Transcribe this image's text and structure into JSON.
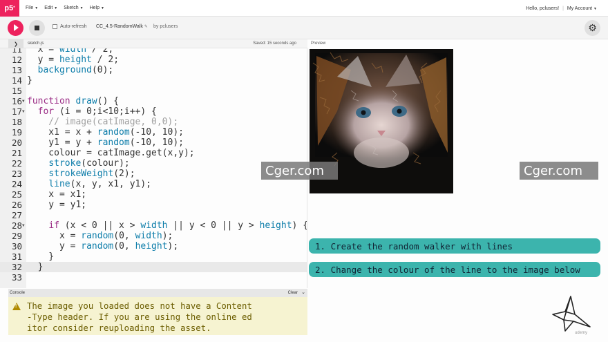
{
  "menubar": {
    "logo": "p5",
    "logo_sup": "*",
    "menus": [
      "File",
      "Edit",
      "Sketch",
      "Help"
    ],
    "greeting": "Hello, pclusers!",
    "account": "My Account"
  },
  "toolbar": {
    "auto_refresh_label": "Auto-refresh",
    "auto_refresh_checked": false,
    "sketch_name": "CC_4.5-RandomWalk",
    "by_user": "by pclusers"
  },
  "editor": {
    "filename": "sketch.js",
    "saved_status": "Saved: 15 seconds ago",
    "lines": [
      {
        "n": "11",
        "code": "  x = width / 2;",
        "fold": false
      },
      {
        "n": "12",
        "code": "  y = height / 2;",
        "fold": false
      },
      {
        "n": "13",
        "code": "  background(0);",
        "fold": false
      },
      {
        "n": "14",
        "code": "}",
        "fold": false
      },
      {
        "n": "15",
        "code": "",
        "fold": false
      },
      {
        "n": "16",
        "code": "function draw() {",
        "fold": true
      },
      {
        "n": "17",
        "code": "  for (i = 0;i<10;i++) {",
        "fold": true
      },
      {
        "n": "18",
        "code": "    // image(catImage, 0,0);",
        "fold": false
      },
      {
        "n": "19",
        "code": "    x1 = x + random(-10, 10);",
        "fold": false
      },
      {
        "n": "20",
        "code": "    y1 = y + random(-10, 10);",
        "fold": false
      },
      {
        "n": "21",
        "code": "    colour = catImage.get(x,y);",
        "fold": false
      },
      {
        "n": "22",
        "code": "    stroke(colour);",
        "fold": false
      },
      {
        "n": "23",
        "code": "    strokeWeight(2);",
        "fold": false
      },
      {
        "n": "24",
        "code": "    line(x, y, x1, y1);",
        "fold": false
      },
      {
        "n": "25",
        "code": "    x = x1;",
        "fold": false
      },
      {
        "n": "26",
        "code": "    y = y1;",
        "fold": false
      },
      {
        "n": "27",
        "code": "",
        "fold": false
      },
      {
        "n": "28",
        "code": "    if (x < 0 || x > width || y < 0 || y > height) {",
        "fold": true
      },
      {
        "n": "29",
        "code": "      x = random(0, width);",
        "fold": false
      },
      {
        "n": "30",
        "code": "      y = random(0, height);",
        "fold": false
      },
      {
        "n": "31",
        "code": "    }",
        "fold": false
      },
      {
        "n": "32",
        "code": "  }",
        "fold": false
      },
      {
        "n": "33",
        "code": "",
        "fold": false
      }
    ],
    "current_line": "32"
  },
  "console": {
    "label": "Console",
    "clear_label": "Clear",
    "message": "The image you loaded does not have a Content\n-Type header. If you are using the online ed\nitor consider reuploading the asset."
  },
  "preview": {
    "label": "Preview"
  },
  "watermarks": [
    "Cger.com",
    "Cger.com"
  ],
  "tasks": [
    "1. Create the random walker with lines",
    "2. Change the colour of the line to the image below"
  ],
  "footer_logo": "udemy",
  "colors": {
    "accent": "#ed225d",
    "task_bg": "#3cb4ad",
    "console_bg": "#f6f3d1"
  }
}
